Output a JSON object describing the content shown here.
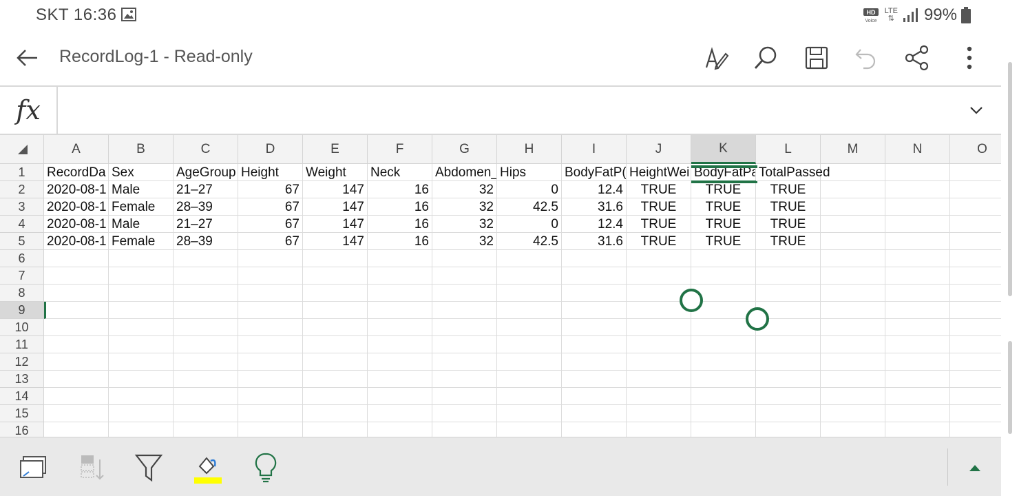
{
  "status": {
    "carrier_time": "SKT 16:36",
    "network": "LTE",
    "battery": "99%"
  },
  "app_bar": {
    "title": "RecordLog-1 - Read-only"
  },
  "formula_bar": {
    "fx": "fx",
    "value": ""
  },
  "columns": [
    "A",
    "B",
    "C",
    "D",
    "E",
    "F",
    "G",
    "H",
    "I",
    "J",
    "K",
    "L",
    "M",
    "N",
    "O"
  ],
  "selected_column": "K",
  "selected_row": "9",
  "rows": [
    "1",
    "2",
    "3",
    "4",
    "5",
    "6",
    "7",
    "8",
    "9",
    "10",
    "11",
    "12",
    "13",
    "14",
    "15",
    "16"
  ],
  "headers": [
    "RecordDa",
    "Sex",
    "AgeGroup",
    "Height",
    "Weight",
    "Neck",
    "Abdomen_",
    "Hips",
    "BodyFatP(",
    "HeightWei",
    "BodyFatPa",
    "TotalPassed"
  ],
  "records": [
    [
      "2020-08-1",
      "Male",
      "21–27",
      "67",
      "147",
      "16",
      "32",
      "0",
      "12.4",
      "TRUE",
      "TRUE",
      "TRUE"
    ],
    [
      "2020-08-1",
      "Female",
      "28–39",
      "67",
      "147",
      "16",
      "32",
      "42.5",
      "31.6",
      "TRUE",
      "TRUE",
      "TRUE"
    ],
    [
      "2020-08-1",
      "Male",
      "21–27",
      "67",
      "147",
      "16",
      "32",
      "0",
      "12.4",
      "TRUE",
      "TRUE",
      "TRUE"
    ],
    [
      "2020-08-1",
      "Female",
      "28–39",
      "67",
      "147",
      "16",
      "32",
      "42.5",
      "31.6",
      "TRUE",
      "TRUE",
      "TRUE"
    ]
  ],
  "colors": {
    "accent": "#217346",
    "fill_highlight": "#ffff00",
    "idea": "#217346"
  },
  "bottom_toolbar": [
    "card-view-icon",
    "sort-icon",
    "filter-icon",
    "fill-color-icon",
    "ideas-icon",
    "collapse-up-icon"
  ]
}
